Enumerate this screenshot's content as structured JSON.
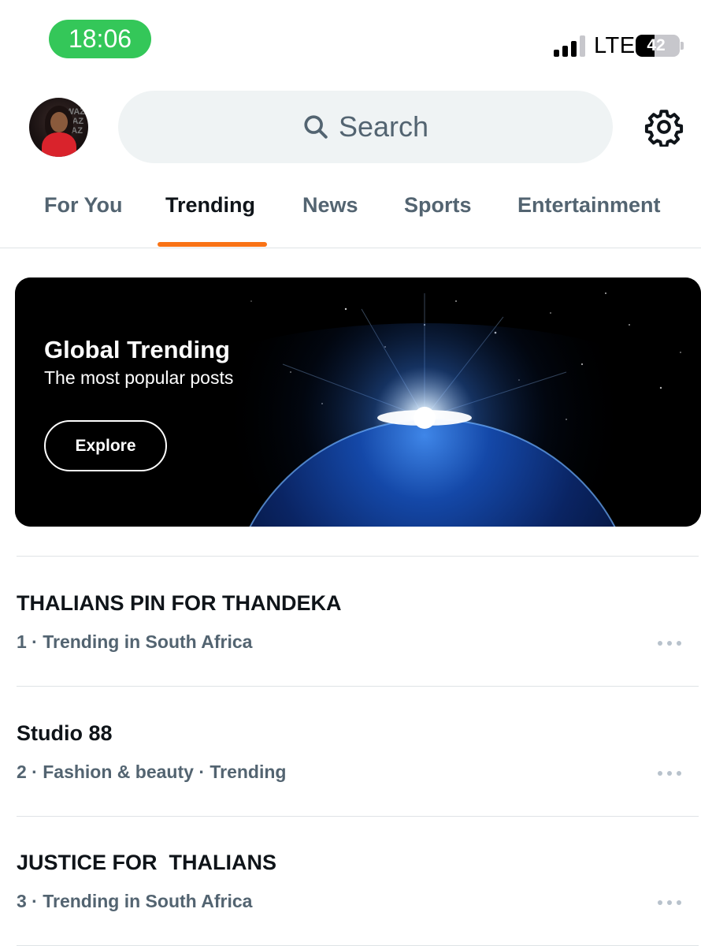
{
  "status_bar": {
    "time": "18:06",
    "network": "LTE",
    "battery_level": "42",
    "battery_fraction": 0.42,
    "time_pill_color": "#34c759"
  },
  "header": {
    "avatar_icon": "profile-avatar",
    "search": {
      "placeholder": "Search",
      "icon": "search-icon"
    },
    "settings_icon": "gear-icon"
  },
  "tabs": [
    {
      "label": "For You",
      "active": false
    },
    {
      "label": "Trending",
      "active": true
    },
    {
      "label": "News",
      "active": false
    },
    {
      "label": "Sports",
      "active": false
    },
    {
      "label": "Entertainment",
      "active": false
    }
  ],
  "tab_accent_color": "#f97316",
  "banner": {
    "title": "Global Trending",
    "subtitle": "The most popular posts",
    "button_label": "Explore"
  },
  "trends": [
    {
      "title": "THALIANS PIN FOR THANDEKA",
      "meta": "1 · Trending in South Africa"
    },
    {
      "title": "Studio 88",
      "meta": "2 · Fashion & beauty · Trending"
    },
    {
      "title": "JUSTICE FOR  THALIANS",
      "meta": "3 · Trending in South Africa"
    }
  ]
}
